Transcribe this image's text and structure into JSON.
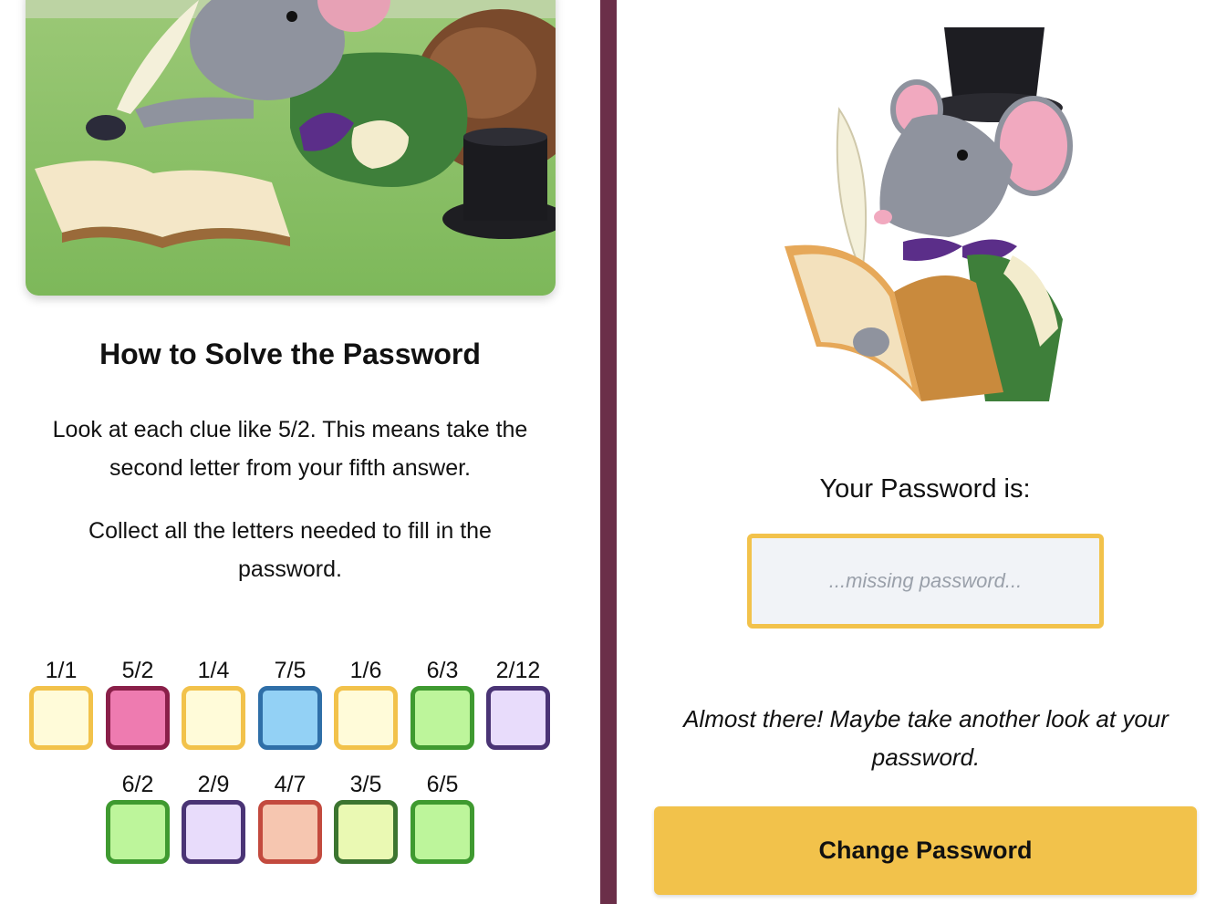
{
  "instructions": {
    "title": "How to Solve the Password",
    "paragraph1": "Look at each clue like 5/2. This means take the second letter from your fifth answer.",
    "paragraph2": "Collect all the letters needed to fill in the password."
  },
  "clues_row1": [
    {
      "label": "1/1",
      "fill": "#fffbd9",
      "border": "#f2c24b"
    },
    {
      "label": "5/2",
      "fill": "#ee7bb0",
      "border": "#8a1f49"
    },
    {
      "label": "1/4",
      "fill": "#fffbd9",
      "border": "#f2c24b"
    },
    {
      "label": "7/5",
      "fill": "#93d1f5",
      "border": "#2f6fa8"
    },
    {
      "label": "1/6",
      "fill": "#fffbd9",
      "border": "#f2c24b"
    },
    {
      "label": "6/3",
      "fill": "#bdf59b",
      "border": "#3f9a30"
    },
    {
      "label": "2/12",
      "fill": "#e8dcfb",
      "border": "#4a3475"
    }
  ],
  "clues_row2": [
    {
      "label": "6/2",
      "fill": "#bdf59b",
      "border": "#3f9a30"
    },
    {
      "label": "2/9",
      "fill": "#e8dcfb",
      "border": "#4a3475"
    },
    {
      "label": "4/7",
      "fill": "#f6c6b0",
      "border": "#c34a3e"
    },
    {
      "label": "3/5",
      "fill": "#eaf9b3",
      "border": "#3c7530"
    },
    {
      "label": "6/5",
      "fill": "#bdf59b",
      "border": "#3f9a30"
    }
  ],
  "password": {
    "label": "Your Password is:",
    "value": "",
    "placeholder": "...missing password..."
  },
  "feedback": "Almost there! Maybe take another look at your password.",
  "change_button_label": "Change Password",
  "colors": {
    "divider": "#6b2f49",
    "accent": "#f2c24b"
  }
}
